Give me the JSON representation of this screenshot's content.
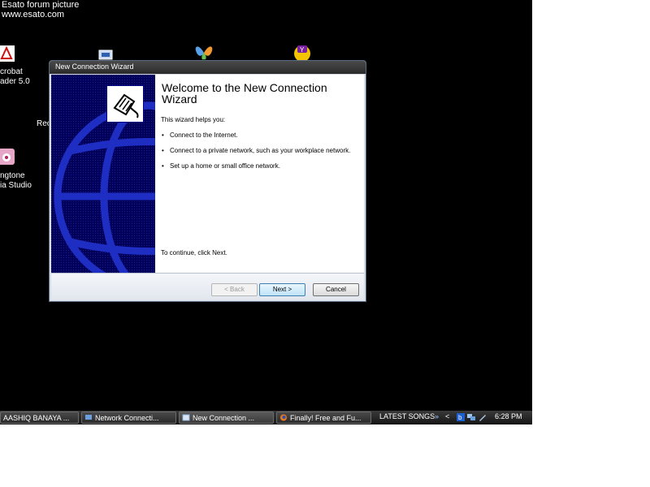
{
  "watermark": {
    "line1": "Esato forum picture",
    "line2": "www.esato.com"
  },
  "desktop_icons": {
    "acrobat": {
      "line1": "crobat",
      "line2": "ader 5.0",
      "icon": "acrobat-icon"
    },
    "recycle": {
      "line1": "Rec",
      "icon": "recycle-bin-icon"
    },
    "ringtone": {
      "line1": "ngtone",
      "line2": "ia Studio",
      "icon": "ringtone-studio-icon"
    },
    "network": {
      "icon": "network-icon"
    },
    "msn": {
      "icon": "msn-butterfly-icon"
    },
    "yahoo": {
      "icon": "yahoo-messenger-icon"
    }
  },
  "window": {
    "title": "New Connection Wizard",
    "heading": "Welcome to the New Connection Wizard",
    "intro": "This wizard helps you:",
    "bullets": [
      "Connect to the Internet.",
      "Connect to a private network, such as your workplace network.",
      "Set up a home or small office network."
    ],
    "continue_text": "To continue, click Next.",
    "buttons": {
      "back": "< Back",
      "next": "Next >",
      "cancel": "Cancel"
    }
  },
  "taskbar": {
    "items": [
      {
        "label": "AASHIQ BANAYA ...",
        "icon": "media-icon"
      },
      {
        "label": "Network Connecti...",
        "icon": "network-connections-icon"
      },
      {
        "label": "New Connection ...",
        "icon": "wizard-icon"
      },
      {
        "label": "Finally! Free and Fu...",
        "icon": "firefox-icon"
      }
    ],
    "toolbar_label": "LATEST SONGS",
    "chevron": "»",
    "tray_arrow": "<",
    "clock": "6:28 PM"
  },
  "colors": {
    "desktop": "#000000",
    "sidebar": "#00005a",
    "next_button": "#bfe3f8"
  }
}
